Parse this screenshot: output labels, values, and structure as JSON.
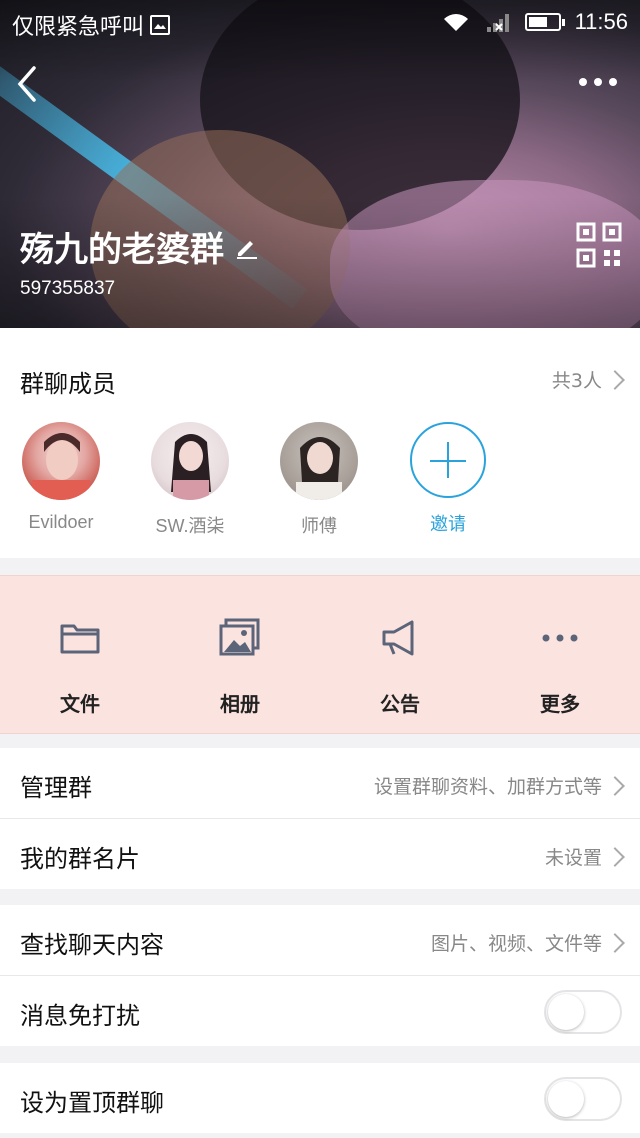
{
  "status_bar": {
    "carrier_text": "仅限紧急呼叫",
    "time": "11:56",
    "icons": [
      "image-icon",
      "wifi-icon",
      "signal-icon",
      "battery-icon"
    ]
  },
  "header": {
    "group_name": "殇九的老婆群",
    "group_id": "597355837",
    "icons": [
      "back-icon",
      "more-icon",
      "edit-icon",
      "qr-code-icon"
    ]
  },
  "members": {
    "title": "群聊成员",
    "count_label": "共3人",
    "items": [
      {
        "name": "Evildoer"
      },
      {
        "name": "SW.酒柒"
      },
      {
        "name": "师傅"
      }
    ],
    "invite_label": "邀请"
  },
  "quick_actions": {
    "items": [
      {
        "label": "文件",
        "icon": "folder-icon"
      },
      {
        "label": "相册",
        "icon": "album-icon"
      },
      {
        "label": "公告",
        "icon": "megaphone-icon"
      },
      {
        "label": "更多",
        "icon": "more-dots-icon"
      }
    ]
  },
  "settings": {
    "manage": {
      "title": "管理群",
      "value": "设置群聊资料、加群方式等"
    },
    "card": {
      "title": "我的群名片",
      "value": "未设置"
    },
    "search": {
      "title": "查找聊天内容",
      "value": "图片、视频、文件等"
    },
    "mute": {
      "title": "消息免打扰",
      "enabled": false
    },
    "pin": {
      "title": "设为置顶群聊",
      "enabled": false
    }
  },
  "colors": {
    "accent": "#2aa3dd",
    "quick_bg": "#fbe3e0"
  }
}
